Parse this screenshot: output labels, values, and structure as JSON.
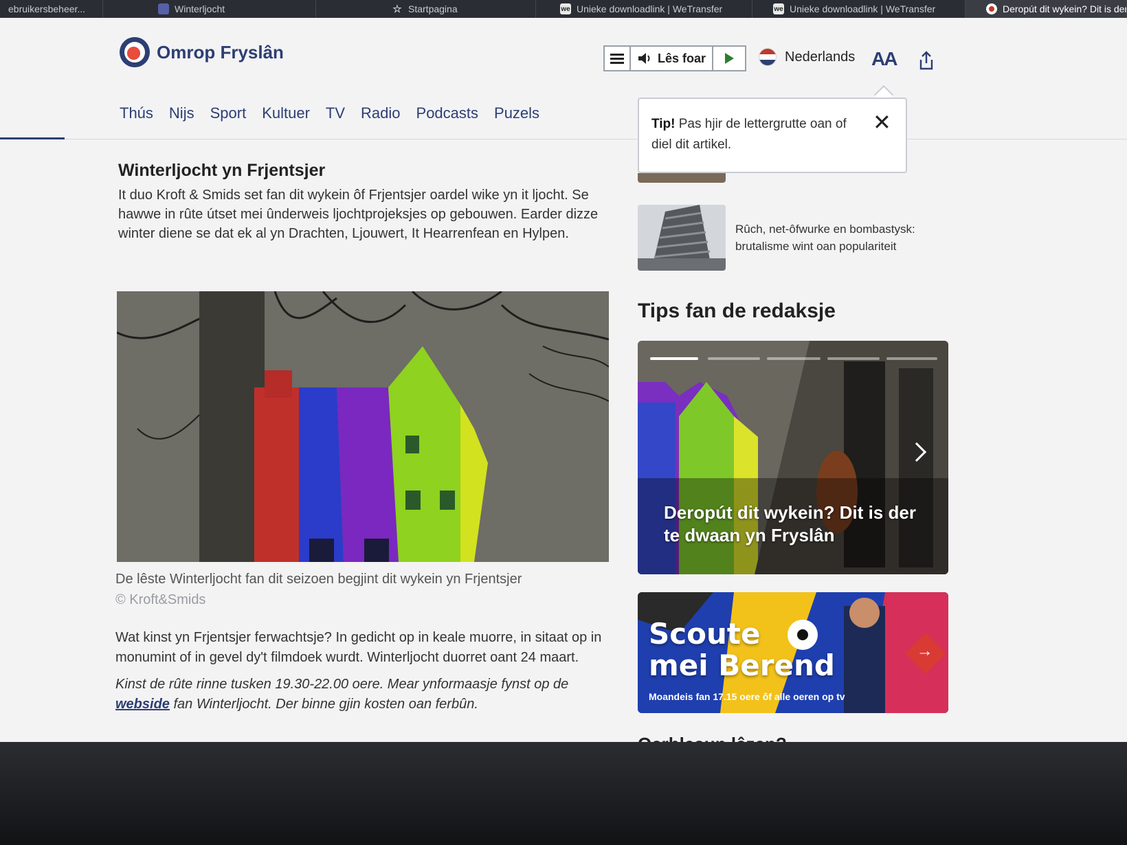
{
  "browser_tabs": [
    {
      "title": "ebruikersbeheer...",
      "icon": "generic"
    },
    {
      "title": "Winterljocht",
      "icon": "generic"
    },
    {
      "title": "Startpagina",
      "icon": "star"
    },
    {
      "title": "Unieke downloadlink | WeTransfer",
      "icon": "wetransfer"
    },
    {
      "title": "Unieke downloadlink | WeTransfer",
      "icon": "wetransfer"
    },
    {
      "title": "Deropút dit wykein? Dit is der",
      "icon": "omrop",
      "active": true
    }
  ],
  "header": {
    "logo_text": "Omrop Fryslân",
    "read_label": "Lês foar",
    "language": "Nederlands",
    "font_size_label": "AA"
  },
  "nav": {
    "items": [
      "Thús",
      "Nijs",
      "Sport",
      "Kultuer",
      "TV",
      "Radio",
      "Podcasts",
      "Puzels"
    ]
  },
  "tip": {
    "bold": "Tip!",
    "text": " Pas hjir de lettergrutte oan of diel dit artikel."
  },
  "article": {
    "title": "Winterljocht yn Frjentsjer",
    "lead": "It duo Kroft & Smids set fan dit wykein ôf Frjentsjer oardel wike yn it ljocht. Se hawwe in rûte útset mei ûnderweis ljochtprojeksjes op gebouwen. Earder dizze winter diene se dat ek al yn Drachten, Ljouwert, It Hearrenfean en Hylpen.",
    "caption": "De lêste Winterljocht fan dit seizoen begjint dit wykein yn Frjentsjer",
    "credit": "© Kroft&Smids",
    "body1": "Wat kinst yn Frjentsjer ferwachtsje? In gedicht op in keale muorre, in sitaat op in monumint of in gevel dy't filmdoek wurdt. Winterljocht duorret oant 24 maart.",
    "body2_before": "Kinst de rûte rinne tusken 19.30-22.00 oere. Mear ynformaasje fynst op de ",
    "body2_link": "webside",
    "body2_after": " fan Winterljocht. Der binne gjin kosten oan ferbûn."
  },
  "sidebar": {
    "related_text": "Rûch, net-ôfwurke en bombastysk: brutalisme wint oan populariteit",
    "tips_title": "Tips fan de redaksje",
    "card1_title": "Deropút dit wykein? Dit is der te dwaan yn Fryslân",
    "card2_title_line1": "Scoute",
    "card2_title_line2": "mei Berend",
    "card2_sub": "Moandeis fan 17.15 oere ôf alle oeren op tv",
    "next_heading": "Oerbleaun lêzen?"
  },
  "colors": {
    "brand": "#2c3e73",
    "accent": "#c0392b",
    "page_bg": "#f3f3f4"
  }
}
